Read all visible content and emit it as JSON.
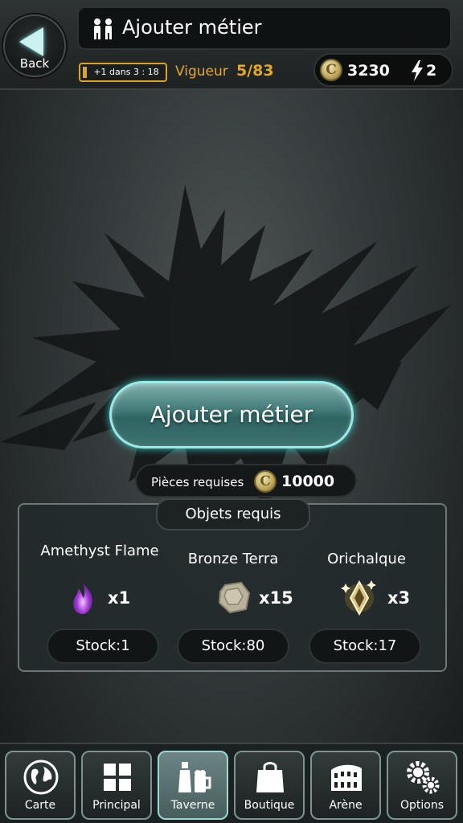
{
  "header": {
    "back_label": "Back",
    "title": "Ajouter métier",
    "timer_text": "+1 dans 3 : 18",
    "vigueur_label": "Vigueur",
    "vigueur_value": "5/83",
    "coins": "3230",
    "energy": "2",
    "coin_symbol": "C"
  },
  "main": {
    "add_button_label": "Ajouter métier",
    "coins_required_label": "Pièces requises",
    "coins_required_value": "10000"
  },
  "objects": {
    "title": "Objets requis",
    "items": [
      {
        "name": "Amethyst Flame",
        "qty": "x1",
        "stock": "Stock:1",
        "icon": "amethyst-flame-icon"
      },
      {
        "name": "Bronze Terra",
        "qty": "x15",
        "stock": "Stock:80",
        "icon": "bronze-terra-icon"
      },
      {
        "name": "Orichalque",
        "qty": "x3",
        "stock": "Stock:17",
        "icon": "orichalque-icon"
      }
    ]
  },
  "nav": {
    "items": [
      {
        "label": "Carte",
        "icon": "globe-icon"
      },
      {
        "label": "Principal",
        "icon": "grid-icon"
      },
      {
        "label": "Taverne",
        "icon": "drinks-icon",
        "active": true
      },
      {
        "label": "Boutique",
        "icon": "shopping-bag-icon"
      },
      {
        "label": "Arène",
        "icon": "colosseum-icon"
      },
      {
        "label": "Options",
        "icon": "gears-icon"
      }
    ]
  },
  "colors": {
    "accent_gold": "#e3a822",
    "button_teal": "#3f7775",
    "glow": "#9ae9e6"
  }
}
